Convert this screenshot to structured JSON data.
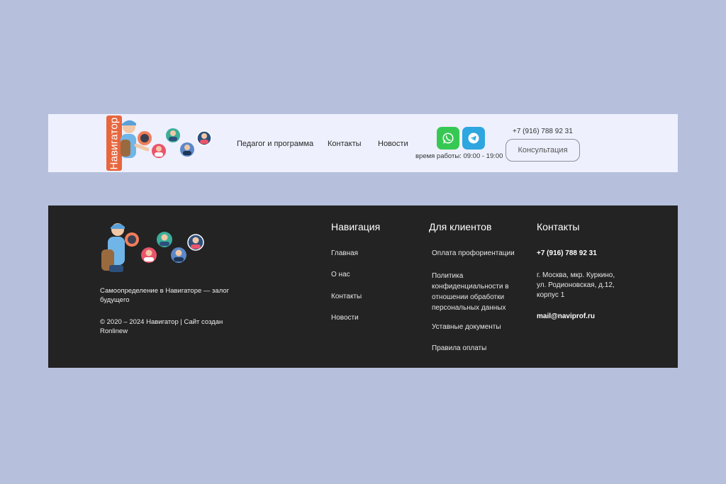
{
  "header": {
    "logo_text": "Навигатор",
    "nav": [
      "Педагог и программа",
      "Контакты",
      "Новости"
    ],
    "social": [
      "whatsapp-icon",
      "telegram-icon"
    ],
    "work_hours": "время работы: 09:00 - 19:00",
    "phone": "+7 (916) 788 92 31",
    "consult_label": "Консультация"
  },
  "footer": {
    "tagline": "Самоопределение в Навигаторе — залог будущего",
    "copyright": "© 2020 – 2024 Навигатор | Сайт создан Ronlinew",
    "navigation": {
      "title": "Навигация",
      "items": [
        "Главная",
        "О нас",
        "Контакты",
        "Новости"
      ]
    },
    "clients": {
      "title": "Для клиентов",
      "items": [
        "Оплата профориентации",
        "Политика конфиденциальности в отношении обработки персональных данных",
        "Уставные документы",
        "Правила оплаты"
      ]
    },
    "contacts": {
      "title": "Контакты",
      "phone": "+7 (916) 788 92 31",
      "address": "г. Москва, мкр. Куркино, ул. Родионовская, д.12, корпус 1",
      "email": "mail@naviprof.ru"
    }
  },
  "colors": {
    "page_bg": "#b6c0dc",
    "header_bg": "#eef0fd",
    "footer_bg": "#232323",
    "logo_badge": "#e8663d",
    "whatsapp": "#37c854",
    "telegram": "#2ea6e0"
  }
}
